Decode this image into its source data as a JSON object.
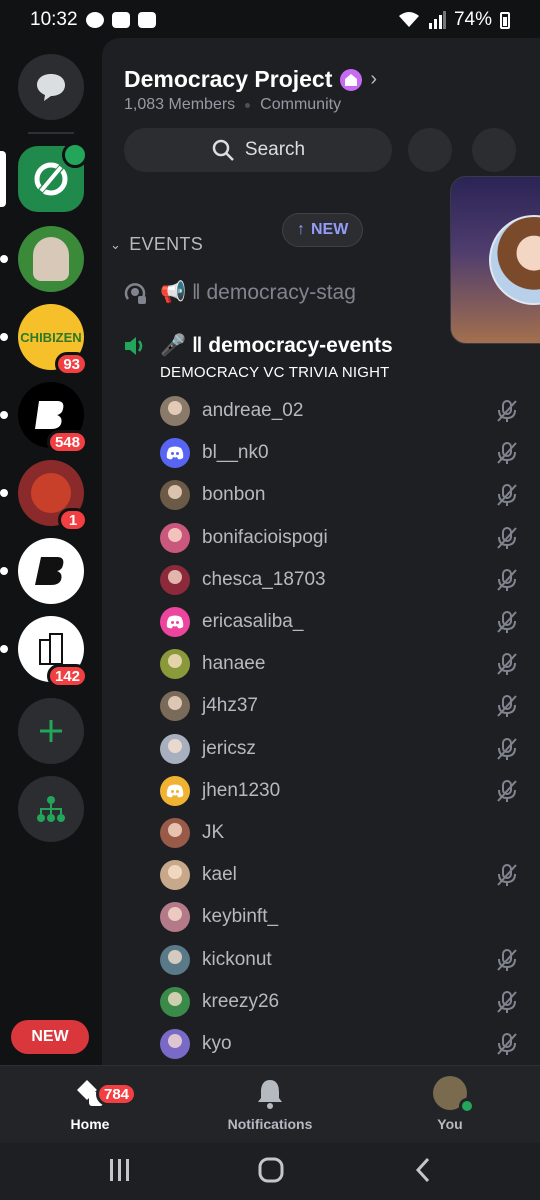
{
  "status_bar": {
    "time": "10:32",
    "battery": "74%"
  },
  "server": {
    "name": "Democracy Project",
    "members": "1,083 Members",
    "type": "Community"
  },
  "search": {
    "label": "Search"
  },
  "category": {
    "name": "EVENTS"
  },
  "new_pill": {
    "label": "NEW",
    "arrow": "↑"
  },
  "channels": {
    "stage": {
      "name": "📢 ǁ democracy-stag"
    },
    "voice": {
      "name": "🎤 ǁ democracy-events",
      "event": "DEMOCRACY VC TRIVIA NIGHT"
    }
  },
  "members": [
    {
      "name": "andreae_02",
      "avatar_color": "#8a7a6a",
      "muted": true
    },
    {
      "name": "bl__nk0",
      "avatar_color": "#5865f2",
      "discord": true,
      "muted": true
    },
    {
      "name": "bonbon",
      "avatar_color": "#6b5a45",
      "muted": true
    },
    {
      "name": "bonifacioispogi",
      "avatar_color": "#c9587c",
      "muted": true
    },
    {
      "name": "chesca_18703",
      "avatar_color": "#8c2a3c",
      "muted": true
    },
    {
      "name": "ericasaliba_",
      "avatar_color": "#eb459e",
      "discord": true,
      "muted": true
    },
    {
      "name": "hanaee",
      "avatar_color": "#8a9a3a",
      "muted": true
    },
    {
      "name": "j4hz37",
      "avatar_color": "#7a6a5a",
      "muted": true
    },
    {
      "name": "jericsz",
      "avatar_color": "#a8b0c0",
      "muted": true
    },
    {
      "name": "jhen1230",
      "avatar_color": "#f0b232",
      "discord": true,
      "muted": true
    },
    {
      "name": "JK",
      "avatar_color": "#9a5a4a",
      "muted": false
    },
    {
      "name": "kael",
      "avatar_color": "#c8a88a",
      "muted": true
    },
    {
      "name": "keybinft_",
      "avatar_color": "#b57a8a",
      "muted": false
    },
    {
      "name": "kickonut",
      "avatar_color": "#5a7a8a",
      "muted": true
    },
    {
      "name": "kreezy26",
      "avatar_color": "#3a8a4a",
      "muted": true
    },
    {
      "name": "kyo",
      "avatar_color": "#7a6ac8",
      "muted": true
    }
  ],
  "servers": [
    {
      "label": "CHIBIZEN",
      "badge": "93"
    },
    {
      "label": "",
      "badge": "548"
    },
    {
      "label": "",
      "badge": "1"
    },
    {
      "label": "",
      "badge": "142"
    }
  ],
  "new_button": {
    "label": "NEW"
  },
  "nav": {
    "home": {
      "label": "Home",
      "badge": "784"
    },
    "notifications": {
      "label": "Notifications"
    },
    "you": {
      "label": "You"
    }
  },
  "colors": {
    "accent": "#5865f2",
    "online": "#23a55a",
    "badge": "#f23f42"
  }
}
